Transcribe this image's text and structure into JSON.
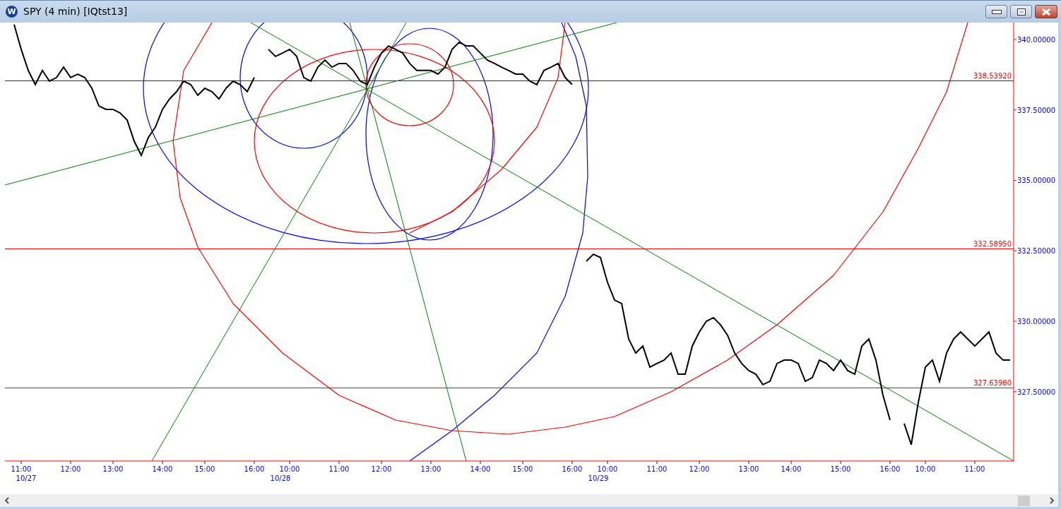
{
  "window": {
    "title": "SPY (4 min) [IQtst13]",
    "app_icon_text": "W"
  },
  "chart": {
    "chart_data": {
      "type": "line",
      "ylim": [
        325.04,
        340.6
      ],
      "yticks": [
        {
          "value": 327.5,
          "label": "327.50000"
        },
        {
          "value": 330,
          "label": "330.00000"
        },
        {
          "value": 332.5,
          "label": "332.50000"
        },
        {
          "value": 335,
          "label": "335.00000"
        },
        {
          "value": 337.5,
          "label": "337.50000"
        },
        {
          "value": 340,
          "label": "340.00000"
        }
      ],
      "categories": [
        null,
        null,
        "11:00",
        null,
        null,
        null,
        null,
        null,
        null,
        "12:00",
        null,
        null,
        null,
        null,
        null,
        "13:00",
        null,
        null,
        null,
        null,
        null,
        null,
        "14:00",
        null,
        null,
        null,
        null,
        null,
        "15:00",
        null,
        null,
        null,
        null,
        null,
        null,
        "16:00",
        null,
        null,
        null,
        null,
        "10:00",
        null,
        null,
        null,
        null,
        null,
        null,
        "11:00",
        null,
        null,
        null,
        null,
        null,
        "12:00",
        null,
        null,
        null,
        null,
        null,
        null,
        "13:00",
        null,
        null,
        null,
        null,
        null,
        null,
        "14:00",
        null,
        null,
        null,
        null,
        null,
        "15:00",
        null,
        null,
        null,
        null,
        null,
        null,
        "16:00",
        null,
        null,
        null,
        null,
        "10:00",
        null,
        null,
        null,
        null,
        null,
        null,
        "11:00",
        null,
        null,
        null,
        null,
        null,
        "12:00",
        null,
        null,
        null,
        null,
        null,
        null,
        "13:00",
        null,
        null,
        null,
        null,
        null,
        "14:00",
        null,
        null,
        null,
        null,
        null,
        null,
        "15:00",
        null,
        null,
        null,
        null,
        null,
        null,
        "16:00",
        null,
        null,
        null,
        null,
        "10:00",
        null,
        null,
        null,
        null,
        null,
        null,
        "11:00",
        null,
        null,
        null,
        null,
        null
      ],
      "series": [
        {
          "color": "#000000",
          "values": [
            null,
            340.53,
            339.65,
            338.9,
            338.4,
            338.9,
            338.52,
            338.65,
            339.02,
            338.65,
            338.77,
            338.65,
            338.27,
            337.64,
            337.52,
            337.52,
            337.39,
            337.14,
            336.39,
            335.89,
            336.52,
            336.89,
            337.52,
            337.89,
            338.15,
            338.52,
            338.4,
            338.02,
            338.27,
            338.15,
            337.89,
            338.27,
            338.52,
            338.4,
            338.15,
            338.65,
            null,
            339.65,
            339.4,
            339.52,
            339.65,
            339.4,
            338.65,
            338.52,
            339.02,
            339.27,
            339.02,
            339.15,
            339.15,
            338.9,
            338.52,
            338.4,
            339.02,
            339.52,
            339.77,
            339.65,
            339.52,
            339.15,
            338.9,
            338.9,
            338.9,
            338.77,
            339.02,
            339.65,
            339.9,
            339.77,
            339.77,
            339.52,
            339.27,
            339.15,
            339.02,
            338.9,
            338.77,
            338.77,
            338.52,
            338.4,
            338.9,
            339.02,
            339.15,
            338.65,
            338.4,
            null,
            332.13,
            332.38,
            332.26,
            331.38,
            330.75,
            330.63,
            329.37,
            328.87,
            329.12,
            328.37,
            328.5,
            328.62,
            328.87,
            328.12,
            328.12,
            329.12,
            329.62,
            330.0,
            330.13,
            329.87,
            329.5,
            328.87,
            328.5,
            328.25,
            328.12,
            327.75,
            327.87,
            328.5,
            328.62,
            328.62,
            328.5,
            327.87,
            328.0,
            328.62,
            328.5,
            328.25,
            328.62,
            328.25,
            328.12,
            329.12,
            329.37,
            328.62,
            327.37,
            326.49,
            null,
            326.37,
            325.62,
            327.12,
            328.37,
            328.62,
            327.87,
            328.87,
            329.37,
            329.62,
            329.37,
            329.12,
            329.37,
            329.62,
            328.87,
            328.62,
            328.62
          ]
        }
      ],
      "annotations": [
        "10/27",
        "10/28",
        "10/29"
      ]
    },
    "level_lines": [
      {
        "label": "338.53920",
        "color": "#303030"
      },
      {
        "label": "332.58950",
        "color": "#ff0000"
      },
      {
        "label": "327.63980",
        "color": "#ff0000"
      }
    ]
  }
}
